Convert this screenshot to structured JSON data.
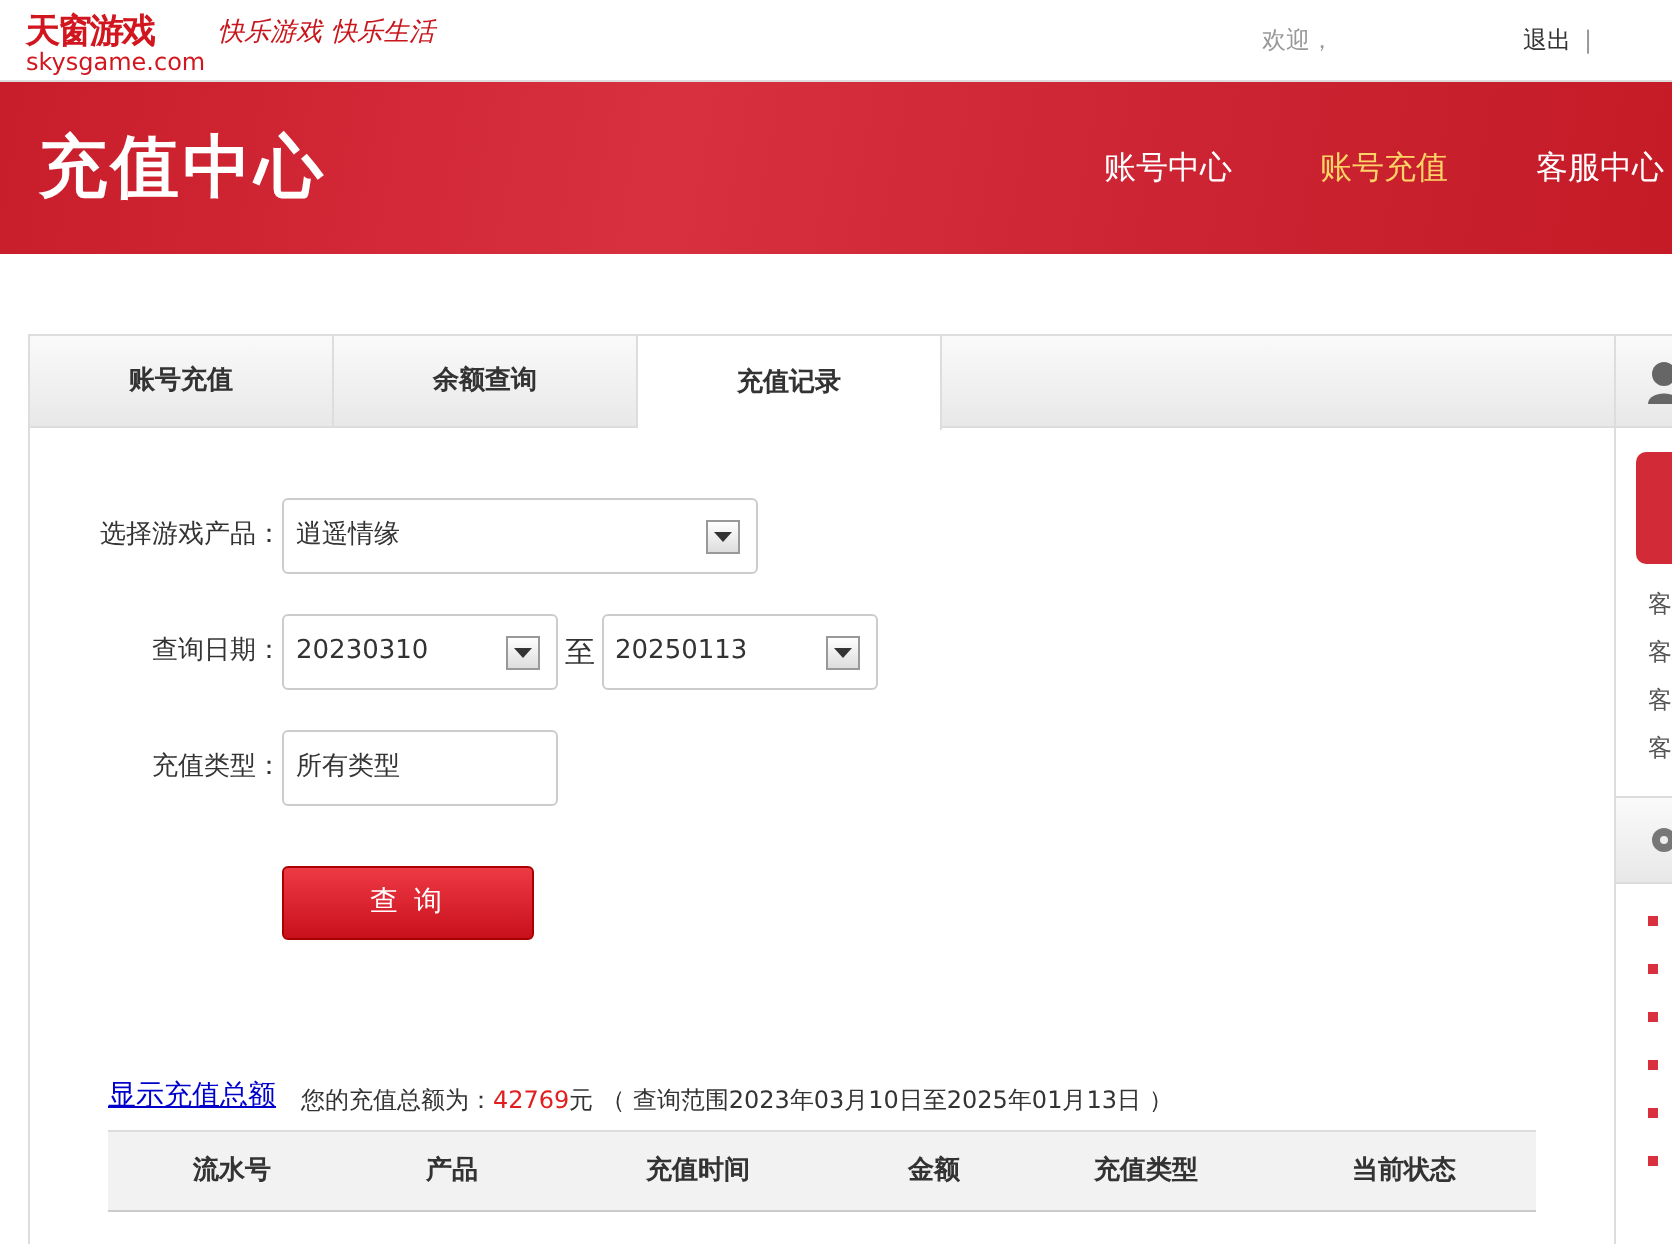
{
  "logo": {
    "name": "天窗游戏",
    "domain": "skysgame.com",
    "slogan": "快乐游戏 快乐生活"
  },
  "topbar": {
    "welcome": "欢迎，",
    "logout": "退出",
    "separator": "|"
  },
  "banner": {
    "title": "充值中心",
    "nav": [
      {
        "label": "账号中心",
        "selected": false
      },
      {
        "label": "账号充值",
        "selected": true
      },
      {
        "label": "客服中心",
        "selected": false
      }
    ]
  },
  "tabs": [
    {
      "label": "账号充值",
      "selected": false
    },
    {
      "label": "余额查询",
      "selected": false
    },
    {
      "label": "充值记录",
      "selected": true
    }
  ],
  "form": {
    "product_label": "选择游戏产品：",
    "product": "逍遥情缘",
    "date_label": "查询日期：",
    "date_from": "20230310",
    "date_to_sep": "至",
    "date_to": "20250113",
    "type_label": "充值类型：",
    "type": "所有类型",
    "submit": "查 询"
  },
  "summary": {
    "link": "显示充值总额",
    "text": "您的充值总额为：",
    "amount": "42769",
    "unit": "元",
    "range": "（ 查询范围2023年03月10日至2025年01月13日 ）"
  },
  "table": {
    "columns": [
      "流水号",
      "产品",
      "充值时间",
      "金额",
      "充值类型",
      "当前状态"
    ]
  },
  "sidebar": {
    "service_items": [
      "客",
      "客",
      "客",
      "客"
    ],
    "bullet_count_items": [
      {
        "kind": "bullet"
      },
      {
        "kind": "bullet"
      },
      {
        "kind": "bullet"
      },
      {
        "kind": "bullet"
      },
      {
        "kind": "bullet"
      },
      {
        "kind": "bullet"
      }
    ]
  }
}
